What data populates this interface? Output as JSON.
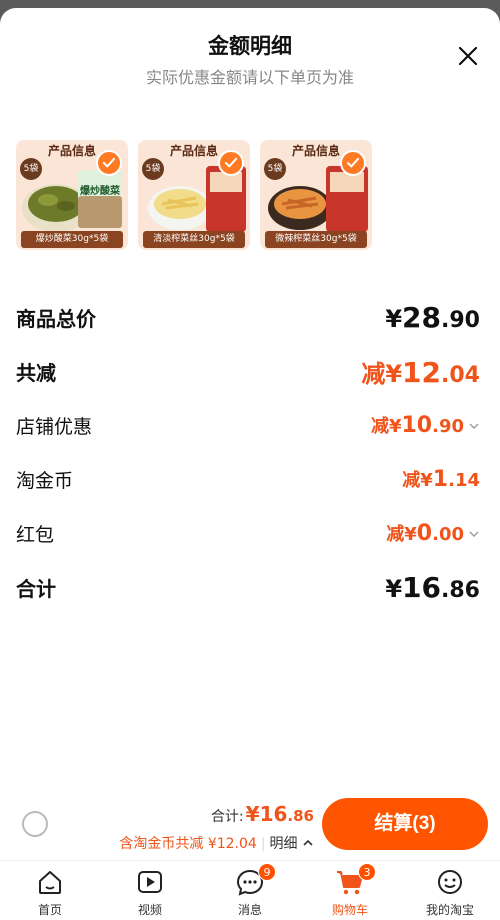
{
  "header": {
    "title": "金额明细",
    "subtitle": "实际优惠金额请以下单页为准",
    "close_icon": "close-icon"
  },
  "products": [
    {
      "header": "产品信息",
      "bags": "5袋",
      "label": "爆炒酸菜30g*5袋",
      "selected": true,
      "pack_text": "爆炒酸菜"
    },
    {
      "header": "产品信息",
      "bags": "5袋",
      "label": "清淡榨菜丝30g*5袋",
      "selected": true
    },
    {
      "header": "产品信息",
      "bags": "5袋",
      "label": "微辣榨菜丝30g*5袋",
      "selected": true
    }
  ],
  "rows": {
    "goods_total": {
      "label": "商品总价",
      "currency": "¥",
      "int": "28",
      "dec": ".90"
    },
    "total_reduce": {
      "label": "共减",
      "prefix": "减¥",
      "int": "12",
      "dec": ".04"
    },
    "shop_discount": {
      "label": "店铺优惠",
      "prefix": "减¥",
      "int": "10",
      "dec": ".90"
    },
    "taojin_coin": {
      "label": "淘金币",
      "prefix": "减¥",
      "int": "1",
      "dec": ".14"
    },
    "red_packet": {
      "label": "红包",
      "prefix": "减¥",
      "int": "0",
      "dec": ".00"
    },
    "sum": {
      "label": "合计",
      "currency": "¥",
      "int": "16",
      "dec": ".86"
    }
  },
  "bottom_bar": {
    "total_label": "合计:",
    "total_currency": "¥",
    "total_int": "16",
    "total_dec": ".86",
    "sub_text": "含淘金币共减 ¥12.04",
    "detail_label": "明细",
    "checkout_label": "结算(3)"
  },
  "tabbar": [
    {
      "label": "首页",
      "icon": "home-icon"
    },
    {
      "label": "视频",
      "icon": "video-icon"
    },
    {
      "label": "消息",
      "icon": "message-icon",
      "badge": "9"
    },
    {
      "label": "购物车",
      "icon": "cart-icon",
      "badge": "3",
      "active": true
    },
    {
      "label": "我的淘宝",
      "icon": "profile-icon"
    }
  ],
  "colors": {
    "accent": "#ff5500",
    "price": "#f0541b"
  }
}
